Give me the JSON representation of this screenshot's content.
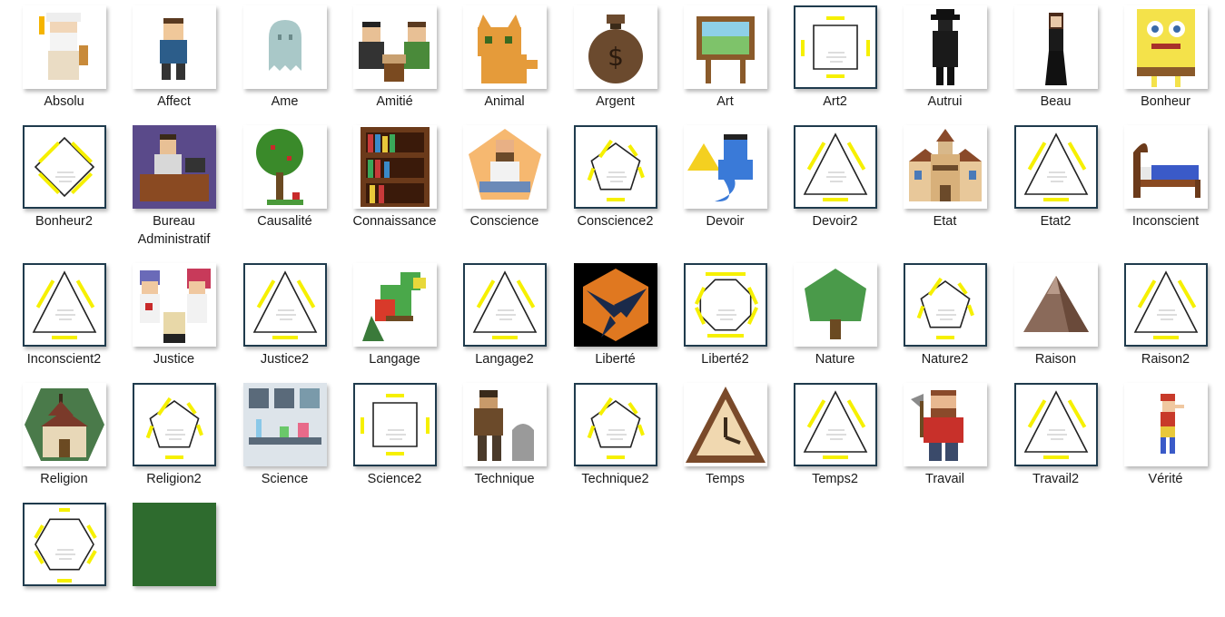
{
  "items": [
    {
      "label": "Absolu",
      "kind": "pixel",
      "icon": "old-sage-icon"
    },
    {
      "label": "Affect",
      "kind": "pixel",
      "icon": "sad-boy-icon"
    },
    {
      "label": "Ame",
      "kind": "pixel",
      "icon": "ghost-icon"
    },
    {
      "label": "Amitié",
      "kind": "pixel",
      "icon": "two-friends-icon"
    },
    {
      "label": "Animal",
      "kind": "pixel",
      "icon": "cat-icon"
    },
    {
      "label": "Argent",
      "kind": "pixel",
      "icon": "money-bag-icon"
    },
    {
      "label": "Art",
      "kind": "pixel",
      "icon": "easel-icon"
    },
    {
      "label": "Art2",
      "kind": "diagram",
      "shape": "square",
      "icon": "square-diagram-icon"
    },
    {
      "label": "Autrui",
      "kind": "pixel",
      "icon": "dark-stranger-icon"
    },
    {
      "label": "Beau",
      "kind": "pixel",
      "icon": "elegant-woman-icon"
    },
    {
      "label": "Bonheur",
      "kind": "pixel",
      "icon": "sponge-character-icon"
    },
    {
      "label": "Bonheur2",
      "kind": "diagram",
      "shape": "diamond",
      "icon": "diamond-diagram-icon"
    },
    {
      "label": "Bureau Administratif",
      "kind": "pixel",
      "icon": "office-clerk-icon"
    },
    {
      "label": "Causalité",
      "kind": "pixel",
      "icon": "apple-tree-icon"
    },
    {
      "label": "Connaissance",
      "kind": "pixel",
      "icon": "bookshelf-icon"
    },
    {
      "label": "Conscience",
      "kind": "pixel",
      "icon": "meditating-man-icon"
    },
    {
      "label": "Conscience2",
      "kind": "diagram",
      "shape": "pentagon",
      "icon": "pentagon-diagram-icon"
    },
    {
      "label": "Devoir",
      "kind": "pixel",
      "icon": "genie-icon"
    },
    {
      "label": "Devoir2",
      "kind": "diagram",
      "shape": "triangle",
      "icon": "triangle-diagram-icon"
    },
    {
      "label": "Etat",
      "kind": "pixel",
      "icon": "town-hall-icon"
    },
    {
      "label": "Etat2",
      "kind": "diagram",
      "shape": "triangle",
      "icon": "triangle-diagram-icon"
    },
    {
      "label": "Inconscient",
      "kind": "pixel",
      "icon": "bed-icon"
    },
    {
      "label": "Inconscient2",
      "kind": "diagram",
      "shape": "triangle",
      "icon": "triangle-diagram-icon"
    },
    {
      "label": "Justice",
      "kind": "pixel",
      "icon": "rocket-trio-icon"
    },
    {
      "label": "Justice2",
      "kind": "diagram",
      "shape": "triangle",
      "icon": "triangle-diagram-icon"
    },
    {
      "label": "Langage",
      "kind": "pixel",
      "icon": "parrot-icon"
    },
    {
      "label": "Langage2",
      "kind": "diagram",
      "shape": "triangle",
      "icon": "triangle-diagram-icon"
    },
    {
      "label": "Liberté",
      "kind": "pixel",
      "icon": "swallow-icon"
    },
    {
      "label": "Liberté2",
      "kind": "diagram",
      "shape": "octagon",
      "icon": "octagon-diagram-icon"
    },
    {
      "label": "Nature",
      "kind": "pixel",
      "icon": "green-tree-icon"
    },
    {
      "label": "Nature2",
      "kind": "diagram",
      "shape": "pentagon",
      "icon": "pentagon-diagram-icon"
    },
    {
      "label": "Raison",
      "kind": "pixel",
      "icon": "mountain-icon"
    },
    {
      "label": "Raison2",
      "kind": "diagram",
      "shape": "triangle",
      "icon": "triangle-diagram-icon"
    },
    {
      "label": "Religion",
      "kind": "pixel",
      "icon": "chapel-icon"
    },
    {
      "label": "Religion2",
      "kind": "diagram",
      "shape": "pentagon",
      "icon": "pentagon-diagram-icon"
    },
    {
      "label": "Science",
      "kind": "pixel",
      "icon": "laboratory-icon"
    },
    {
      "label": "Science2",
      "kind": "diagram",
      "shape": "square",
      "icon": "square-diagram-icon"
    },
    {
      "label": "Technique",
      "kind": "pixel",
      "icon": "stone-worker-icon"
    },
    {
      "label": "Technique2",
      "kind": "diagram",
      "shape": "pentagon",
      "icon": "pentagon-diagram-icon"
    },
    {
      "label": "Temps",
      "kind": "pixel",
      "icon": "triangle-clock-icon"
    },
    {
      "label": "Temps2",
      "kind": "diagram",
      "shape": "triangle",
      "icon": "triangle-diagram-icon"
    },
    {
      "label": "Travail",
      "kind": "pixel",
      "icon": "lumberjack-icon"
    },
    {
      "label": "Travail2",
      "kind": "diagram",
      "shape": "triangle",
      "icon": "triangle-diagram-icon"
    },
    {
      "label": "Vérité",
      "kind": "pixel",
      "icon": "pinocchio-icon"
    },
    {
      "label": "",
      "kind": "diagram",
      "shape": "hexagon",
      "icon": "hexagon-diagram-icon"
    },
    {
      "label": "",
      "kind": "solid",
      "fill": "#2e6b2e",
      "icon": "green-square-icon"
    }
  ],
  "colors": {
    "diagram_border": "#1f3b4d",
    "highlight": "#f6f000",
    "label_text": "#1a1a1a"
  }
}
